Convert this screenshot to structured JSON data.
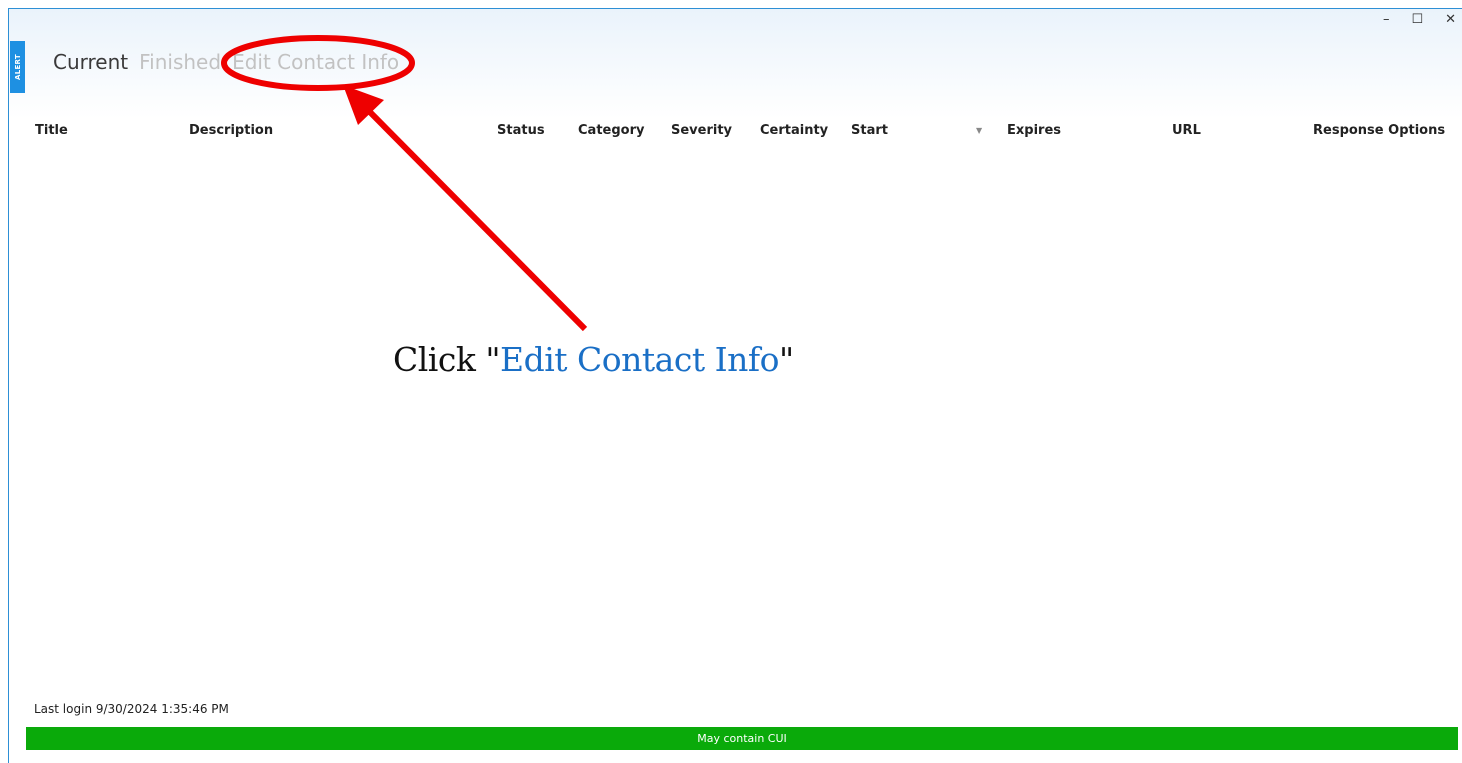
{
  "window": {
    "badge_text": "ALERT",
    "controls": {
      "minimize": "–",
      "maximize": "☐",
      "close": "✕"
    }
  },
  "tabs": [
    {
      "label": "Current",
      "active": true
    },
    {
      "label": "Finished",
      "active": false
    },
    {
      "label": "Edit Contact Info",
      "active": false
    }
  ],
  "table": {
    "columns": [
      "Title",
      "Description",
      "Status",
      "Category",
      "Severity",
      "Certainty",
      "Start",
      "Expires",
      "URL",
      "Response Options"
    ],
    "sort_indicator": "▼",
    "rows": []
  },
  "instruction": {
    "prefix": "Click \"",
    "link_text": "Edit Contact Info",
    "suffix": "\""
  },
  "footer": {
    "last_login": "Last login 9/30/2024 1:35:46 PM",
    "banner": "May contain CUI"
  },
  "colors": {
    "accent": "#1e90e2",
    "annotation": "#ee0000",
    "banner": "#0aaa0a",
    "instruction_link": "#1a6fc6"
  }
}
